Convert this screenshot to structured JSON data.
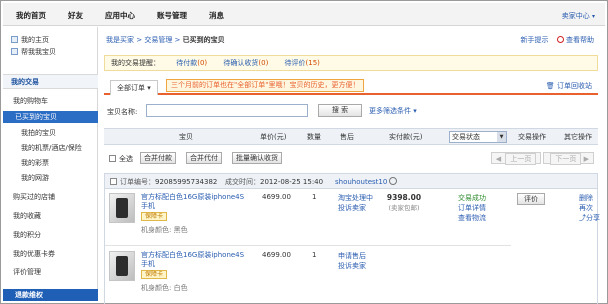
{
  "topnav": [
    "我的首页",
    "好友",
    "应用中心",
    "账号管理",
    "消息"
  ],
  "seller_center": "卖家中心",
  "sidebar": {
    "top_items": [
      "我的主页",
      "帮我我宝贝"
    ],
    "section_trade": "我的交易",
    "items": [
      "我的购物车",
      "已买到的宝贝",
      "我拍的宝贝",
      "我的机票/酒店/保险",
      "我的彩票",
      "我的网游",
      "购买过的店铺",
      "我的收藏",
      "我的积分",
      "我的优惠卡券",
      "评价管理"
    ],
    "footer": "退款维权"
  },
  "breadcrumb": {
    "part1": "我是买家",
    "sep": " > ",
    "part2": "交易管理",
    "current": "已买到的宝贝"
  },
  "help": {
    "tips": "新手提示",
    "help": "查看帮助"
  },
  "reminder": {
    "label": "我的交易提醒：",
    "items": [
      {
        "text": "待付款",
        "count": "(0)"
      },
      {
        "text": "待确认收货",
        "count": "(0)"
      },
      {
        "text": "待评价",
        "count": "(15)"
      }
    ]
  },
  "tabs": {
    "all_orders": "全部订单",
    "notice": "三个月前的订单也在\"全部订单\"里哦！宝贝的历史，更方便！",
    "recycle": "订单回收站"
  },
  "search": {
    "label": "宝贝名称:",
    "button": "搜 索",
    "more": "更多筛选条件"
  },
  "table_headers": {
    "item": "宝贝",
    "unit_price": "单价(元)",
    "qty": "数量",
    "after_sale": "售后",
    "paid": "实付款(元)",
    "status": "交易状态",
    "ops": "交易操作",
    "other": "其它操作"
  },
  "batch": {
    "select_all": "全选",
    "merge_pay": "合并付款",
    "merge_proxy": "合并代付",
    "batch_confirm": "批量确认收货",
    "prev": "上一页",
    "next": "下一页"
  },
  "order": {
    "number_label": "订单编号：",
    "number": "92085995734382",
    "time_label": "成交时间：",
    "time": "2012-08-25 15:40",
    "seller": "shouhoutest10",
    "total": "9398.00",
    "shipping": "(卖家包邮)",
    "status": "交易成功",
    "detail_link": "订单详情",
    "logistics_link": "查看物流",
    "review_button": "评价",
    "other_ops": [
      "删除",
      "再次",
      "分享"
    ],
    "items": [
      {
        "title": "官方标配白色16G原装iphone4S手机",
        "badge": "保障卡",
        "spec": "机身颜色: 黑色",
        "price": "4699.00",
        "qty": "1",
        "after_sale": [
          "淘宝处理中",
          "投诉卖家"
        ]
      },
      {
        "title": "官方标配白色16G原装iphone4S手机",
        "badge": "保障卡",
        "spec": "机身颜色: 白色",
        "price": "4699.00",
        "qty": "1",
        "after_sale": [
          "申请售后",
          "投诉卖家"
        ]
      }
    ]
  },
  "colors": {
    "link": "#2a5db0",
    "active_nav": "#2b6cc4",
    "tab_underline": "#e8612e",
    "status_ok": "#2e8b2e"
  }
}
